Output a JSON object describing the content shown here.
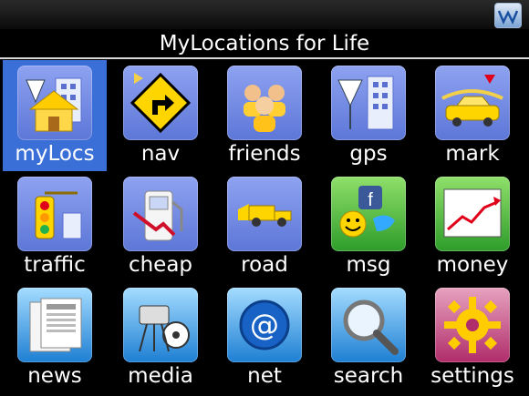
{
  "header": {
    "title": "MyLocations for Life",
    "app_icon": "mylocations-logo"
  },
  "items": [
    {
      "label": "myLocs",
      "icon": "home-city-icon",
      "selected": true
    },
    {
      "label": "nav",
      "icon": "turn-sign-icon"
    },
    {
      "label": "friends",
      "icon": "people-icon"
    },
    {
      "label": "gps",
      "icon": "gps-city-icon"
    },
    {
      "label": "mark",
      "icon": "car-marker-icon"
    },
    {
      "label": "traffic",
      "icon": "traffic-light-icon"
    },
    {
      "label": "cheap",
      "icon": "fuel-pump-icon"
    },
    {
      "label": "road",
      "icon": "tow-truck-icon"
    },
    {
      "label": "msg",
      "icon": "social-messaging-icon"
    },
    {
      "label": "money",
      "icon": "stock-chart-icon"
    },
    {
      "label": "news",
      "icon": "newspaper-icon"
    },
    {
      "label": "media",
      "icon": "film-camera-icon"
    },
    {
      "label": "net",
      "icon": "at-sign-icon"
    },
    {
      "label": "search",
      "icon": "magnifier-icon"
    },
    {
      "label": "settings",
      "icon": "gear-icon"
    }
  ],
  "colors": {
    "background": "#000000",
    "selection": "#3b6fd8",
    "tile": "#7b8fe6"
  }
}
